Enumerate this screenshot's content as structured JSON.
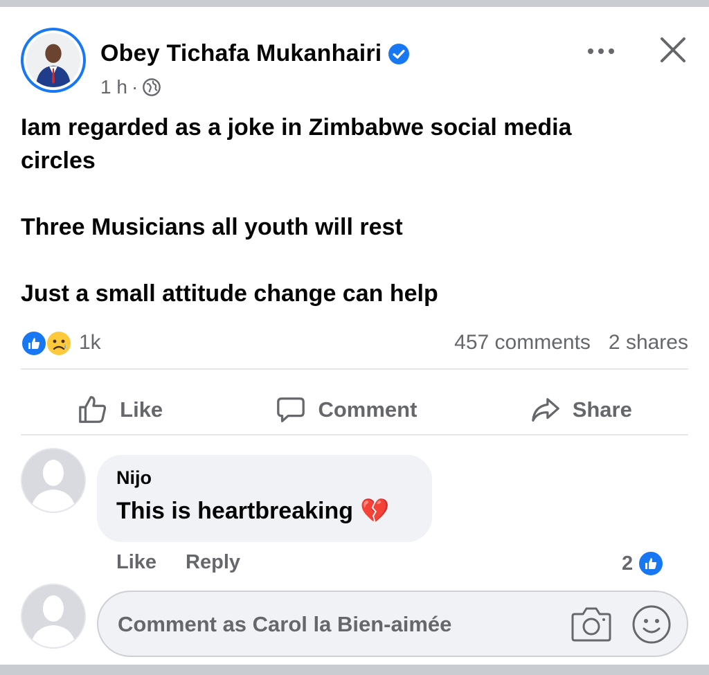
{
  "post": {
    "author": "Obey Tichafa Mukanhairi",
    "time": "1 h",
    "separator": "·",
    "lines": [
      "Iam regarded as a joke in Zimbabwe social media circles",
      "Three Musicians all youth will rest",
      "Just a small attitude change can help"
    ]
  },
  "reactions": {
    "count": "1k",
    "comments": "457 comments",
    "shares": "2 shares",
    "types": [
      "like-icon",
      "sad-icon"
    ]
  },
  "actions": {
    "like": "Like",
    "comment": "Comment",
    "share": "Share"
  },
  "comment": {
    "author": "Nijo",
    "text": "This is heartbreaking",
    "emoji": "💔",
    "like_label": "Like",
    "reply_label": "Reply",
    "likes": "2"
  },
  "compose": {
    "placeholder": "Comment as Carol la Bien-aimée"
  },
  "colors": {
    "accent": "#1877f2",
    "muted_text": "#65676b",
    "bubble": "#f0f2f5"
  }
}
